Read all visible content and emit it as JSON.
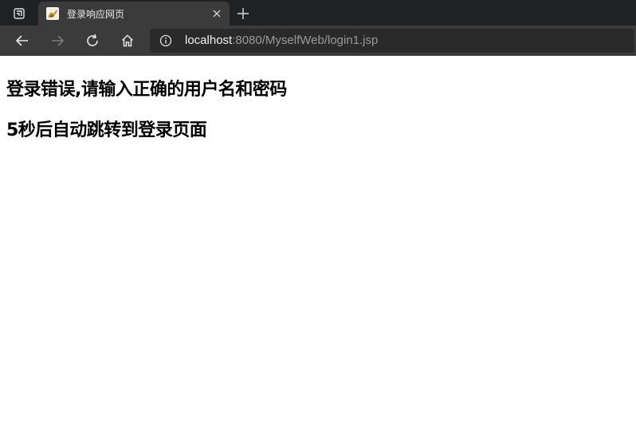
{
  "tab": {
    "title": "登录响应网页",
    "close_icon": "close-icon",
    "favicon": "tomcat-favicon"
  },
  "toolbar": {
    "back_icon": "arrow-left-icon",
    "forward_icon": "arrow-right-icon",
    "reload_icon": "reload-icon",
    "home_icon": "home-icon",
    "info_icon": "info-icon"
  },
  "address": {
    "host": "localhost",
    "rest": ":8080/MyselfWeb/login1.jsp"
  },
  "page": {
    "line1": "登录错误,请输入正确的用户名和密码",
    "line2": "5秒后自动跳转到登录页面"
  }
}
